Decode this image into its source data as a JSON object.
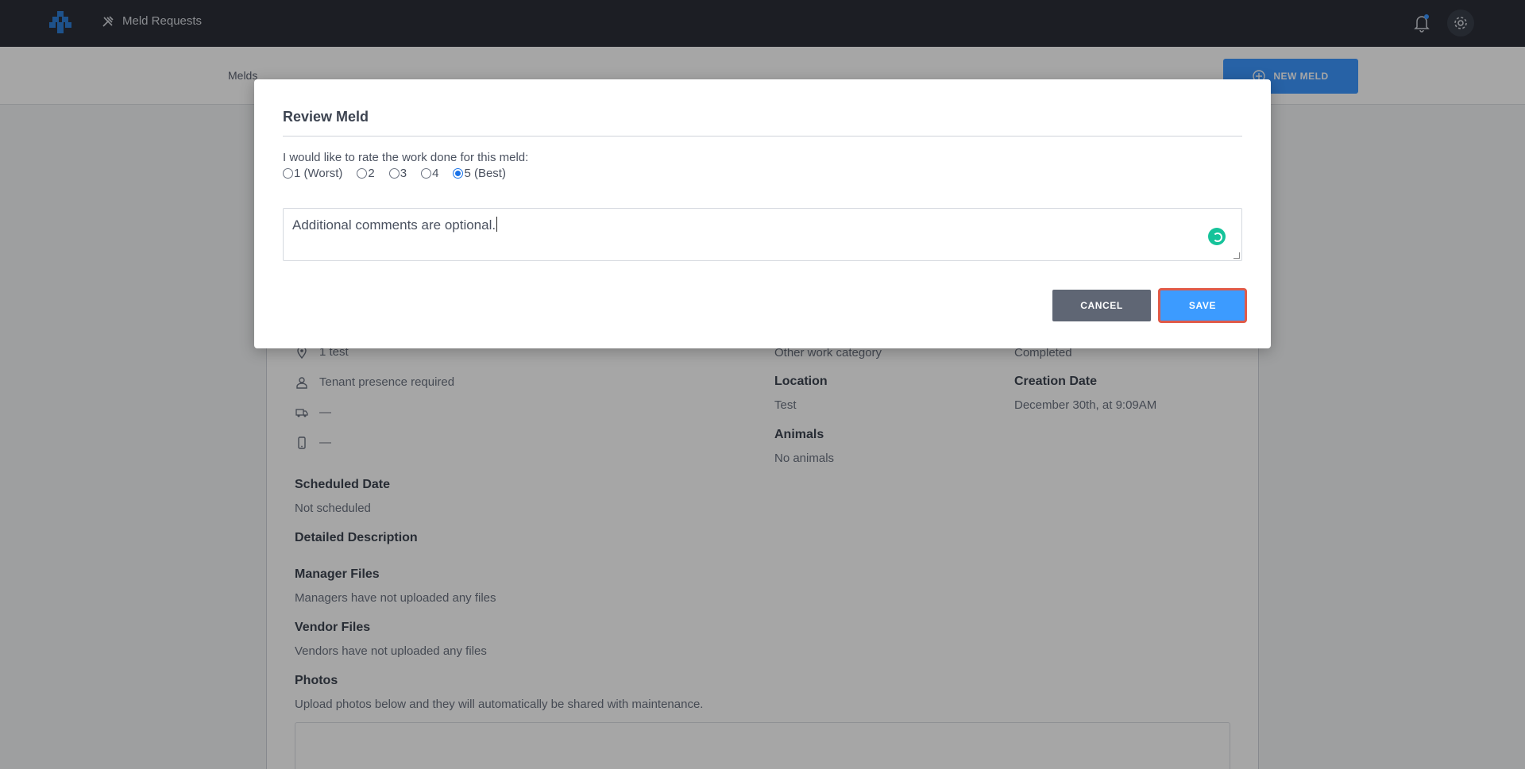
{
  "app": {
    "nav_label": "Meld Requests",
    "icons": {
      "logo": "meld-logo-icon",
      "nav": "tools-icon",
      "bell": "bell-icon",
      "gear": "gear-icon"
    }
  },
  "subheader": {
    "breadcrumb": "Melds",
    "new_meld_label": "NEW MELD"
  },
  "details": {
    "address": "1 test",
    "tenant_presence": "Tenant presence required",
    "vehicle": "—",
    "phone": "—",
    "work_category": "Other work category",
    "status": "Completed",
    "location_label": "Location",
    "location_value": "Test",
    "creation_date_label": "Creation Date",
    "creation_date_value": "December 30th, at 9:09AM",
    "animals_label": "Animals",
    "animals_value": "No animals",
    "scheduled_label": "Scheduled Date",
    "scheduled_value": "Not scheduled",
    "description_label": "Detailed Description",
    "manager_files_label": "Manager Files",
    "manager_files_value": "Managers have not uploaded any files",
    "vendor_files_label": "Vendor Files",
    "vendor_files_value": "Vendors have not uploaded any files",
    "photos_label": "Photos",
    "photos_value": "Upload photos below and they will automatically be shared with maintenance."
  },
  "modal": {
    "title": "Review Meld",
    "prompt": "I would like to rate the work done for this meld:",
    "ratings": [
      {
        "label": "1 (Worst)",
        "checked": false
      },
      {
        "label": "2",
        "checked": false
      },
      {
        "label": "3",
        "checked": false
      },
      {
        "label": "4",
        "checked": false
      },
      {
        "label": "5 (Best)",
        "checked": true
      }
    ],
    "comment_value": "Additional comments are optional.",
    "cancel_label": "CANCEL",
    "save_label": "SAVE",
    "colors": {
      "save": "#3c9bff",
      "cancel": "#5f6674",
      "highlight": "#e05a48"
    }
  }
}
